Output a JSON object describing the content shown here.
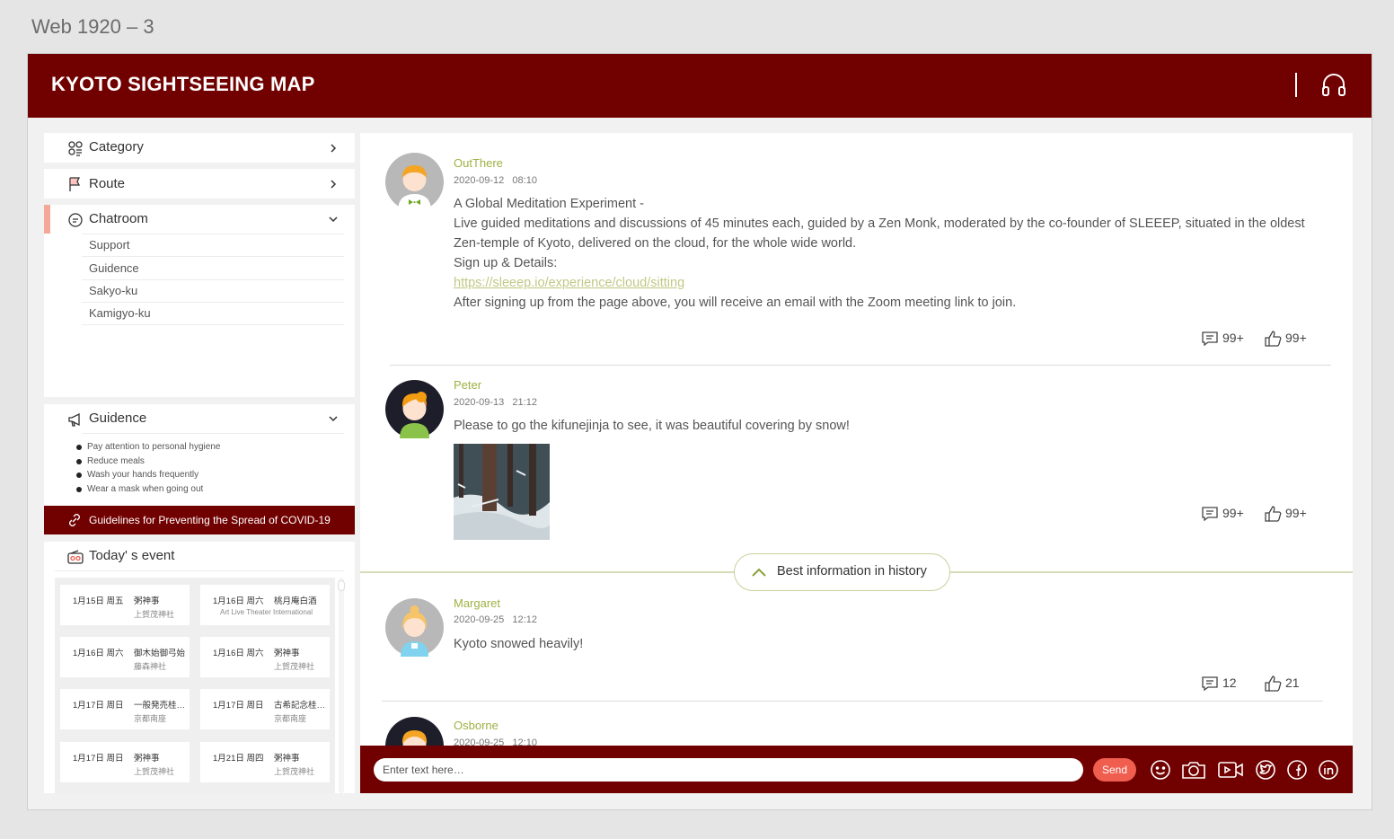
{
  "frame_label": "Web 1920 – 3",
  "app": {
    "title": "KYOTO SIGHTSEEING MAP",
    "header_icon": "headphones-icon"
  },
  "sidebar": {
    "category": "Category",
    "route": "Route",
    "chatroom": "Chatroom",
    "chatroom_items": [
      "Support",
      "Guidence",
      "Sakyo-ku",
      "Kamigyo-ku"
    ],
    "guidence": {
      "title": "Guidence",
      "items": [
        "Pay attention to personal hygiene",
        "Reduce meals",
        "Wash your hands frequently",
        "Wear a mask when going out"
      ],
      "covid_link": "Guidelines for Preventing the Spread of COVID-19"
    },
    "events": {
      "title": "Today' s event",
      "items": [
        {
          "date": "1月15日 周五",
          "name": "粥神事",
          "venue": "上賀茂神社"
        },
        {
          "date": "1月16日 周六",
          "name": "桃月庵白酒",
          "venue": "Art Live Theater International"
        },
        {
          "date": "1月16日 周六",
          "name": "御木始御弓始",
          "venue": "藤森神社"
        },
        {
          "date": "1月16日 周六",
          "name": "粥神事",
          "venue": "上賀茂神社"
        },
        {
          "date": "1月17日 周日",
          "name": "一般発売桂…",
          "venue": "京都南座"
        },
        {
          "date": "1月17日 周日",
          "name": "古希記念桂…",
          "venue": "京都南座"
        },
        {
          "date": "1月17日 周日",
          "name": "粥神事",
          "venue": "上賀茂神社"
        },
        {
          "date": "1月21日 周四",
          "name": "粥神事",
          "venue": "上賀茂神社"
        }
      ]
    }
  },
  "posts": [
    {
      "user": "OutThere",
      "time": "2020-09-12   08:10",
      "lines": [
        "A Global Meditation Experiment -",
        "Live guided meditations and discussions of 45 minutes each, guided by a Zen Monk, moderated by the co-founder of SLEEEP, situated in the oldest",
        "Zen-temple of Kyoto, delivered on the cloud, for the whole wide world.",
        "Sign up & Details:"
      ],
      "link": "https://sleeep.io/experience/cloud/sitting",
      "after": "After signing up from the page above, you will receive an email with the Zoom meeting link to join.",
      "comments": "99+",
      "likes": "99+"
    },
    {
      "user": "Peter",
      "time": "2020-09-13   21:12",
      "text": "Please to go the kifunejinja to see, it was beautiful covering by snow!",
      "comments": "99+",
      "likes": "99+"
    },
    {
      "user": "Margaret",
      "time": "2020-09-25   12:12",
      "text": "Kyoto snowed heavily!",
      "comments": "12",
      "likes": "21"
    },
    {
      "user": "Osborne",
      "time": "2020-09-25   12:10"
    }
  ],
  "best_history": "Best information in history",
  "compose": {
    "placeholder": "Enter text here…",
    "send": "Send"
  },
  "colors": {
    "brand": "#710000",
    "accent": "#9fb043",
    "send": "#f05e4f"
  }
}
